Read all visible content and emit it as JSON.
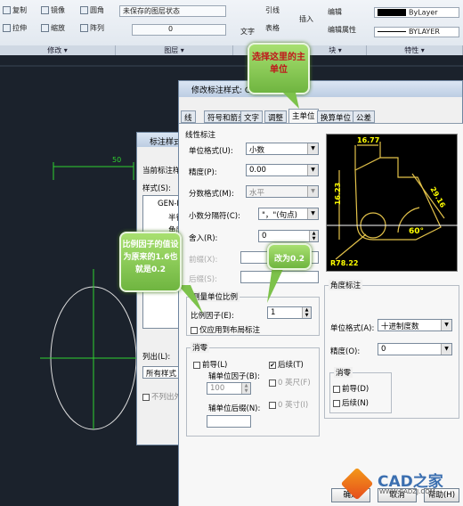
{
  "ribbon": {
    "copy": "复制",
    "mirror": "镜像",
    "fillet": "圆角",
    "stretch": "拉伸",
    "scale": "缩放",
    "array": "阵列",
    "layer_state": "未保存的图层状态",
    "layer_name": "0",
    "text": "文字",
    "leader": "引线",
    "table": "表格",
    "insert": "插入",
    "edit": "编辑",
    "edit_attr": "编辑属性",
    "bylayer1": "ByLayer",
    "bylayer2": "BYLAYER",
    "modify_section": "修改 ▾",
    "layer_section": "图层 ▾",
    "block_section": "块 ▾",
    "props_section": "特性 ▾"
  },
  "drawing": {
    "dim_value": "50"
  },
  "bg_dialog": {
    "title": "标注样式管",
    "current_style": "当前标注样式",
    "styles_label": "样式(S):",
    "style_items": [
      "GEN-ISO",
      "半径",
      "角度"
    ],
    "list_label": "列出(L):",
    "list_value": "所有样式",
    "no_list_xref": "不列出外"
  },
  "dialog": {
    "title": "修改标注样式: GEN-ISO",
    "tabs": [
      "线",
      "符号和箭头",
      "文字",
      "调整",
      "主单位",
      "换算单位",
      "公差"
    ],
    "linear": {
      "section": "线性标注",
      "unit_format_label": "单位格式(U):",
      "unit_format": "小数",
      "precision_label": "精度(P):",
      "precision": "0.00",
      "fraction_label": "分数格式(M):",
      "fraction": "水平",
      "decimal_sep_label": "小数分隔符(C):",
      "decimal_sep": "\"，\"(句点)",
      "round_label": "舍入(R):",
      "round": "0",
      "prefix_label": "前缀(X):",
      "suffix_label": "后缀(S):"
    },
    "scale": {
      "section": "测量单位比例",
      "factor_label": "比例因子(E):",
      "factor": "1",
      "layout_only": "仅应用到布局标注"
    },
    "zero": {
      "section": "消零",
      "leading": "前导(L)",
      "trailing": "后续(T)",
      "trailing_checked": "✔",
      "sub_factor_label": "辅单位因子(B):",
      "sub_factor": "100",
      "sub_suffix_label": "辅单位后缀(N):",
      "feet": "0 英尺(F)",
      "inches": "0 英寸(I)"
    },
    "angular": {
      "section": "角度标注",
      "unit_format_label": "单位格式(A):",
      "unit_format": "十进制度数",
      "precision_label": "精度(O):",
      "precision": "0",
      "zero_section": "消零",
      "leading": "前导(D)",
      "trailing": "后续(N)"
    },
    "preview": {
      "d1": "16.77",
      "d2": "16.23",
      "d3": "29.16",
      "angle": "60°",
      "radius": "R78.22"
    },
    "ok": "确定",
    "cancel": "取消",
    "help": "帮助(H)"
  },
  "callouts": {
    "select_tab": "选择这里的主单位",
    "scale_hint": "比例因子的值设为原来的1.6也就是0.2",
    "change_hint": "改为0.2"
  },
  "watermark": {
    "brand": "CAD之家",
    "url": "WWW.CADZJ.COM"
  },
  "colors": {
    "accent_green": "#7dc24b",
    "callout_text": "#c0161b",
    "preview_line": "#e3c24a"
  }
}
